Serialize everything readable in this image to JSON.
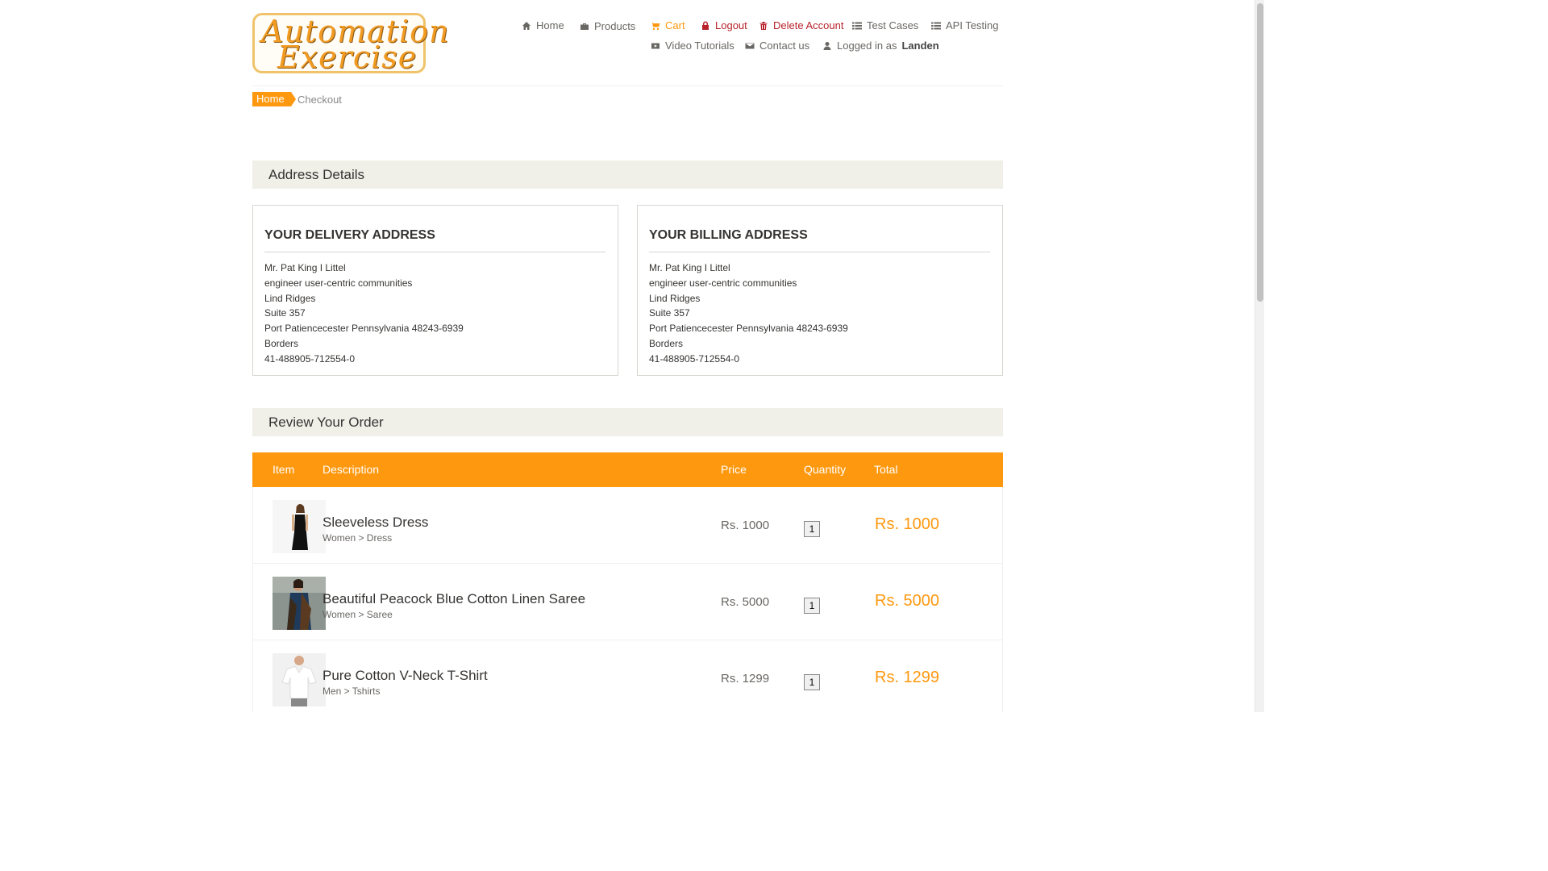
{
  "logo": {
    "line1": "Automation",
    "line2": "Exercise"
  },
  "nav": {
    "home": "Home",
    "products": "Products",
    "cart": "Cart",
    "logout": "Logout",
    "delete_account": "Delete Account",
    "test_cases": "Test Cases",
    "api_testing": "API Testing",
    "video_tutorials": "Video Tutorials",
    "contact_us": "Contact us",
    "logged_in_prefix": "Logged in as",
    "username": "Landen"
  },
  "breadcrumb": {
    "home": "Home",
    "current": "Checkout"
  },
  "address_details": {
    "heading": "Address Details",
    "delivery": {
      "title": "YOUR DELIVERY ADDRESS",
      "lines": [
        "Mr. Pat King I Littel",
        "engineer user-centric communities",
        "Lind Ridges",
        "Suite 357",
        "Port Patiencecester Pennsylvania 48243-6939",
        "Borders",
        "41-488905-712554-0"
      ]
    },
    "billing": {
      "title": "YOUR BILLING ADDRESS",
      "lines": [
        "Mr. Pat King I Littel",
        "engineer user-centric communities",
        "Lind Ridges",
        "Suite 357",
        "Port Patiencecester Pennsylvania 48243-6939",
        "Borders",
        "41-488905-712554-0"
      ]
    }
  },
  "review": {
    "heading": "Review Your Order",
    "columns": {
      "item": "Item",
      "description": "Description",
      "price": "Price",
      "quantity": "Quantity",
      "total": "Total"
    },
    "items": [
      {
        "name": "Sleeveless Dress",
        "category": "Women > Dress",
        "price": "Rs. 1000",
        "quantity": "1",
        "total": "Rs. 1000"
      },
      {
        "name": "Beautiful Peacock Blue Cotton Linen Saree",
        "category": "Women > Saree",
        "price": "Rs. 5000",
        "quantity": "1",
        "total": "Rs. 5000"
      },
      {
        "name": "Pure Cotton V-Neck T-Shirt",
        "category": "Men > Tshirts",
        "price": "Rs. 1299",
        "quantity": "1",
        "total": "Rs. 1299"
      }
    ]
  },
  "colors": {
    "accent": "#FE980F",
    "danger": "#b8232b",
    "section_bg": "#f0f0e9"
  }
}
